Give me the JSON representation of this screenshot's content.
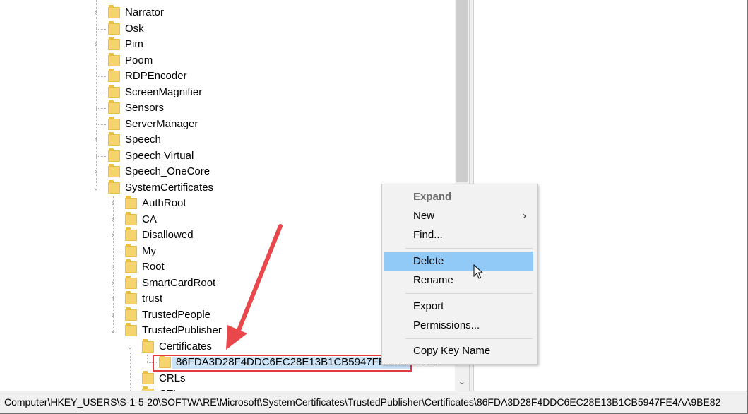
{
  "tree": {
    "nodes": [
      {
        "label": "Narrator",
        "expander": "›",
        "level": 0
      },
      {
        "label": "Osk",
        "expander": "",
        "level": 0
      },
      {
        "label": "Pim",
        "expander": "›",
        "level": 0
      },
      {
        "label": "Poom",
        "expander": "",
        "level": 0
      },
      {
        "label": "RDPEncoder",
        "expander": "",
        "level": 0
      },
      {
        "label": "ScreenMagnifier",
        "expander": "",
        "level": 0
      },
      {
        "label": "Sensors",
        "expander": "",
        "level": 0
      },
      {
        "label": "ServerManager",
        "expander": "",
        "level": 0
      },
      {
        "label": "Speech",
        "expander": "›",
        "level": 0
      },
      {
        "label": "Speech Virtual",
        "expander": "",
        "level": 0
      },
      {
        "label": "Speech_OneCore",
        "expander": "›",
        "level": 0
      },
      {
        "label": "SystemCertificates",
        "expander": "⌄",
        "level": 0
      },
      {
        "label": "AuthRoot",
        "expander": "›",
        "level": 1
      },
      {
        "label": "CA",
        "expander": "›",
        "level": 1
      },
      {
        "label": "Disallowed",
        "expander": "›",
        "level": 1
      },
      {
        "label": "My",
        "expander": "",
        "level": 1
      },
      {
        "label": "Root",
        "expander": "›",
        "level": 1
      },
      {
        "label": "SmartCardRoot",
        "expander": "›",
        "level": 1
      },
      {
        "label": "trust",
        "expander": "›",
        "level": 1
      },
      {
        "label": "TrustedPeople",
        "expander": "›",
        "level": 1
      },
      {
        "label": "TrustedPublisher",
        "expander": "⌄",
        "level": 1
      },
      {
        "label": "Certificates",
        "expander": "⌄",
        "level": 2
      },
      {
        "label": "86FDA3D28F4DDC6EC28E13B1CB5947FE4AA9BE82",
        "expander": "",
        "level": 3
      },
      {
        "label": "CRLs",
        "expander": "",
        "level": 2
      },
      {
        "label": "CTLs",
        "expander": "",
        "level": 2
      }
    ]
  },
  "context_menu": {
    "expand": "Expand",
    "new": "New",
    "new_arrow": "›",
    "find": "Find...",
    "delete": "Delete",
    "rename": "Rename",
    "export": "Export",
    "permissions": "Permissions...",
    "copy_key_name": "Copy Key Name"
  },
  "scrollbar": {
    "down_arrow": "⌄"
  },
  "status_bar": {
    "path": "Computer\\HKEY_USERS\\S-1-5-20\\SOFTWARE\\Microsoft\\SystemCertificates\\TrustedPublisher\\Certificates\\86FDA3D28F4DDC6EC28E13B1CB5947FE4AA9BE82"
  },
  "colors": {
    "folder": "#f5d36d",
    "menu_hover": "#91c9f7",
    "annotation_red": "#e0393e",
    "selection": "#cce4f7"
  },
  "icons": [
    "folder-icon",
    "chevron-right-icon",
    "chevron-down-icon",
    "mouse-cursor-icon",
    "annotation-arrow"
  ]
}
